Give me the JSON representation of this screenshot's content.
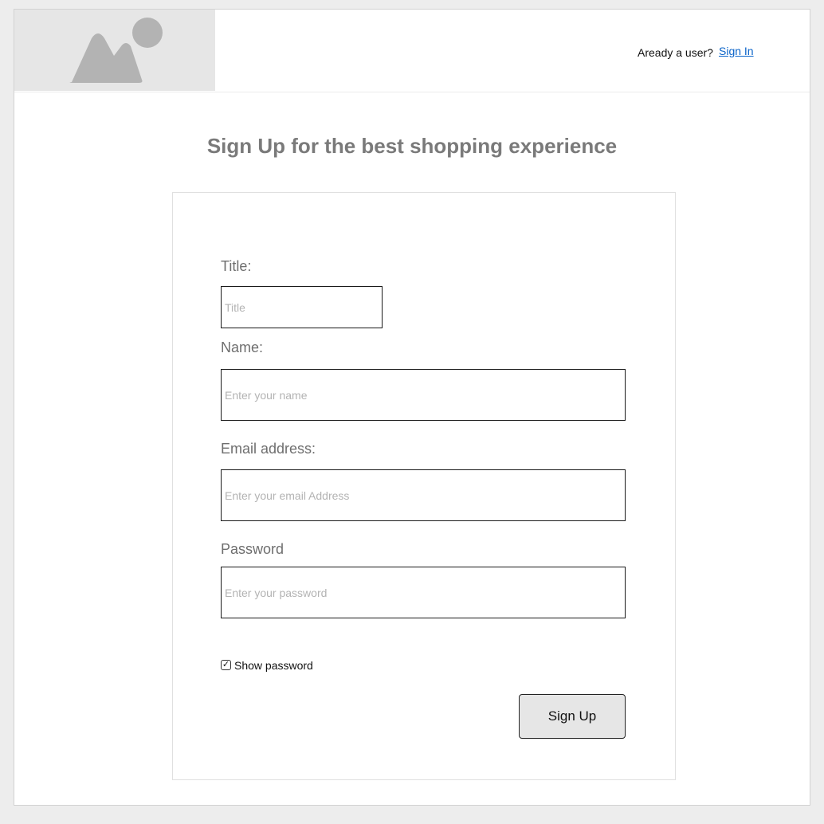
{
  "header": {
    "logo_icon": "image-placeholder-icon",
    "already_user_text": "Aready a user?",
    "signin_link": "Sign In"
  },
  "page": {
    "title": "Sign Up for the best shopping experience"
  },
  "form": {
    "title_label": "Title:",
    "title_placeholder": "Title",
    "name_label": "Name:",
    "name_placeholder": "Enter your name",
    "email_label": "Email address:",
    "email_placeholder": "Enter your email Address",
    "password_label": "Password",
    "password_placeholder": "Enter your password",
    "show_password_checked": true,
    "show_password_mark": "✓",
    "show_password_label": "Show password",
    "submit_label": "Sign Up"
  },
  "colors": {
    "link": "#0b64c9",
    "title": "#7a7a7a",
    "button_bg": "#e6e6e6"
  }
}
